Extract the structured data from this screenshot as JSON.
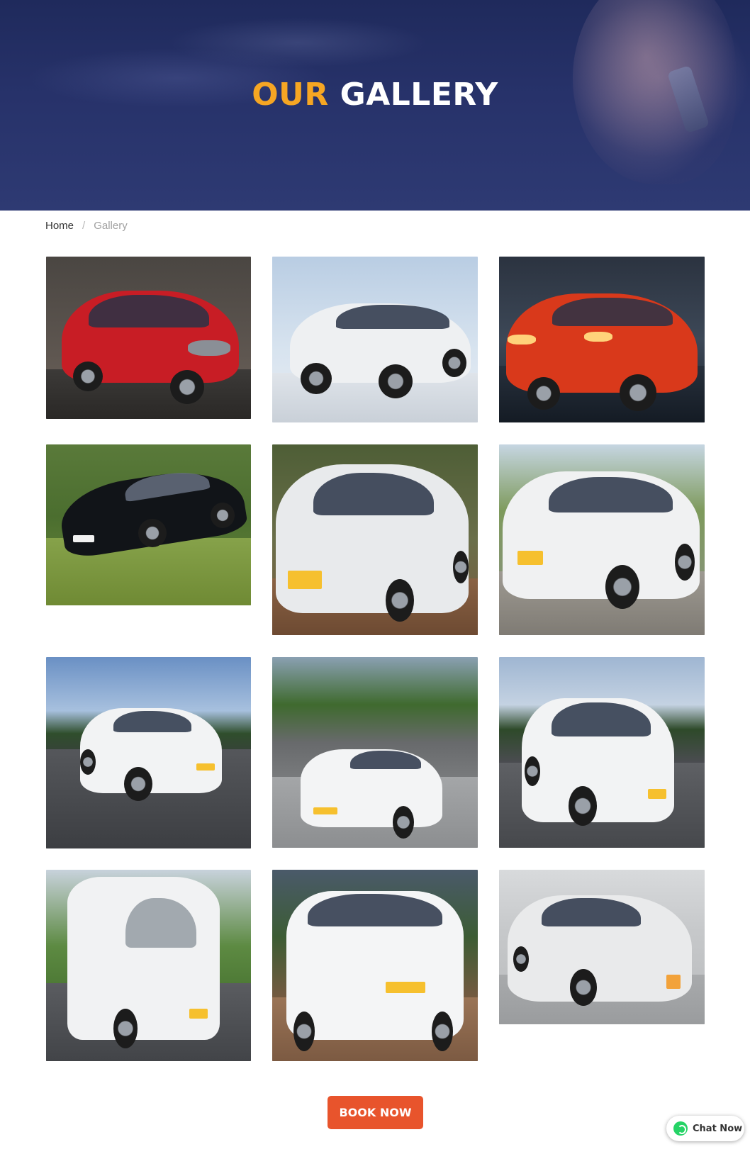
{
  "hero": {
    "title_accent": "OUR",
    "title_main": "GALLERY"
  },
  "breadcrumb": {
    "home": "Home",
    "separator": "/",
    "current": "Gallery"
  },
  "gallery": {
    "images": [
      {
        "subject": "red SUV (MG Hector style) in showroom"
      },
      {
        "subject": "white Range Rover Evoque"
      },
      {
        "subject": "red Mahindra XUV300"
      },
      {
        "subject": "black Lexus sedan on grass"
      },
      {
        "subject": "white Maruti Ertiga"
      },
      {
        "subject": "white Toyota Etios taxi"
      },
      {
        "subject": "white Audi Q7"
      },
      {
        "subject": "white BMW 5 Series"
      },
      {
        "subject": "white Toyota Innova"
      },
      {
        "subject": "white Force Tempo Traveller"
      },
      {
        "subject": "white Toyota Fortuner"
      },
      {
        "subject": "white Maruti Swift Dzire"
      }
    ]
  },
  "cta": {
    "book_label": "BOOK NOW"
  },
  "chat_widget": {
    "label": "Chat Now",
    "icon": "whatsapp-icon"
  },
  "colors": {
    "accent": "#f6a623",
    "button": "#e8542c",
    "hero_bg": "#27326a",
    "whatsapp": "#25d366"
  }
}
